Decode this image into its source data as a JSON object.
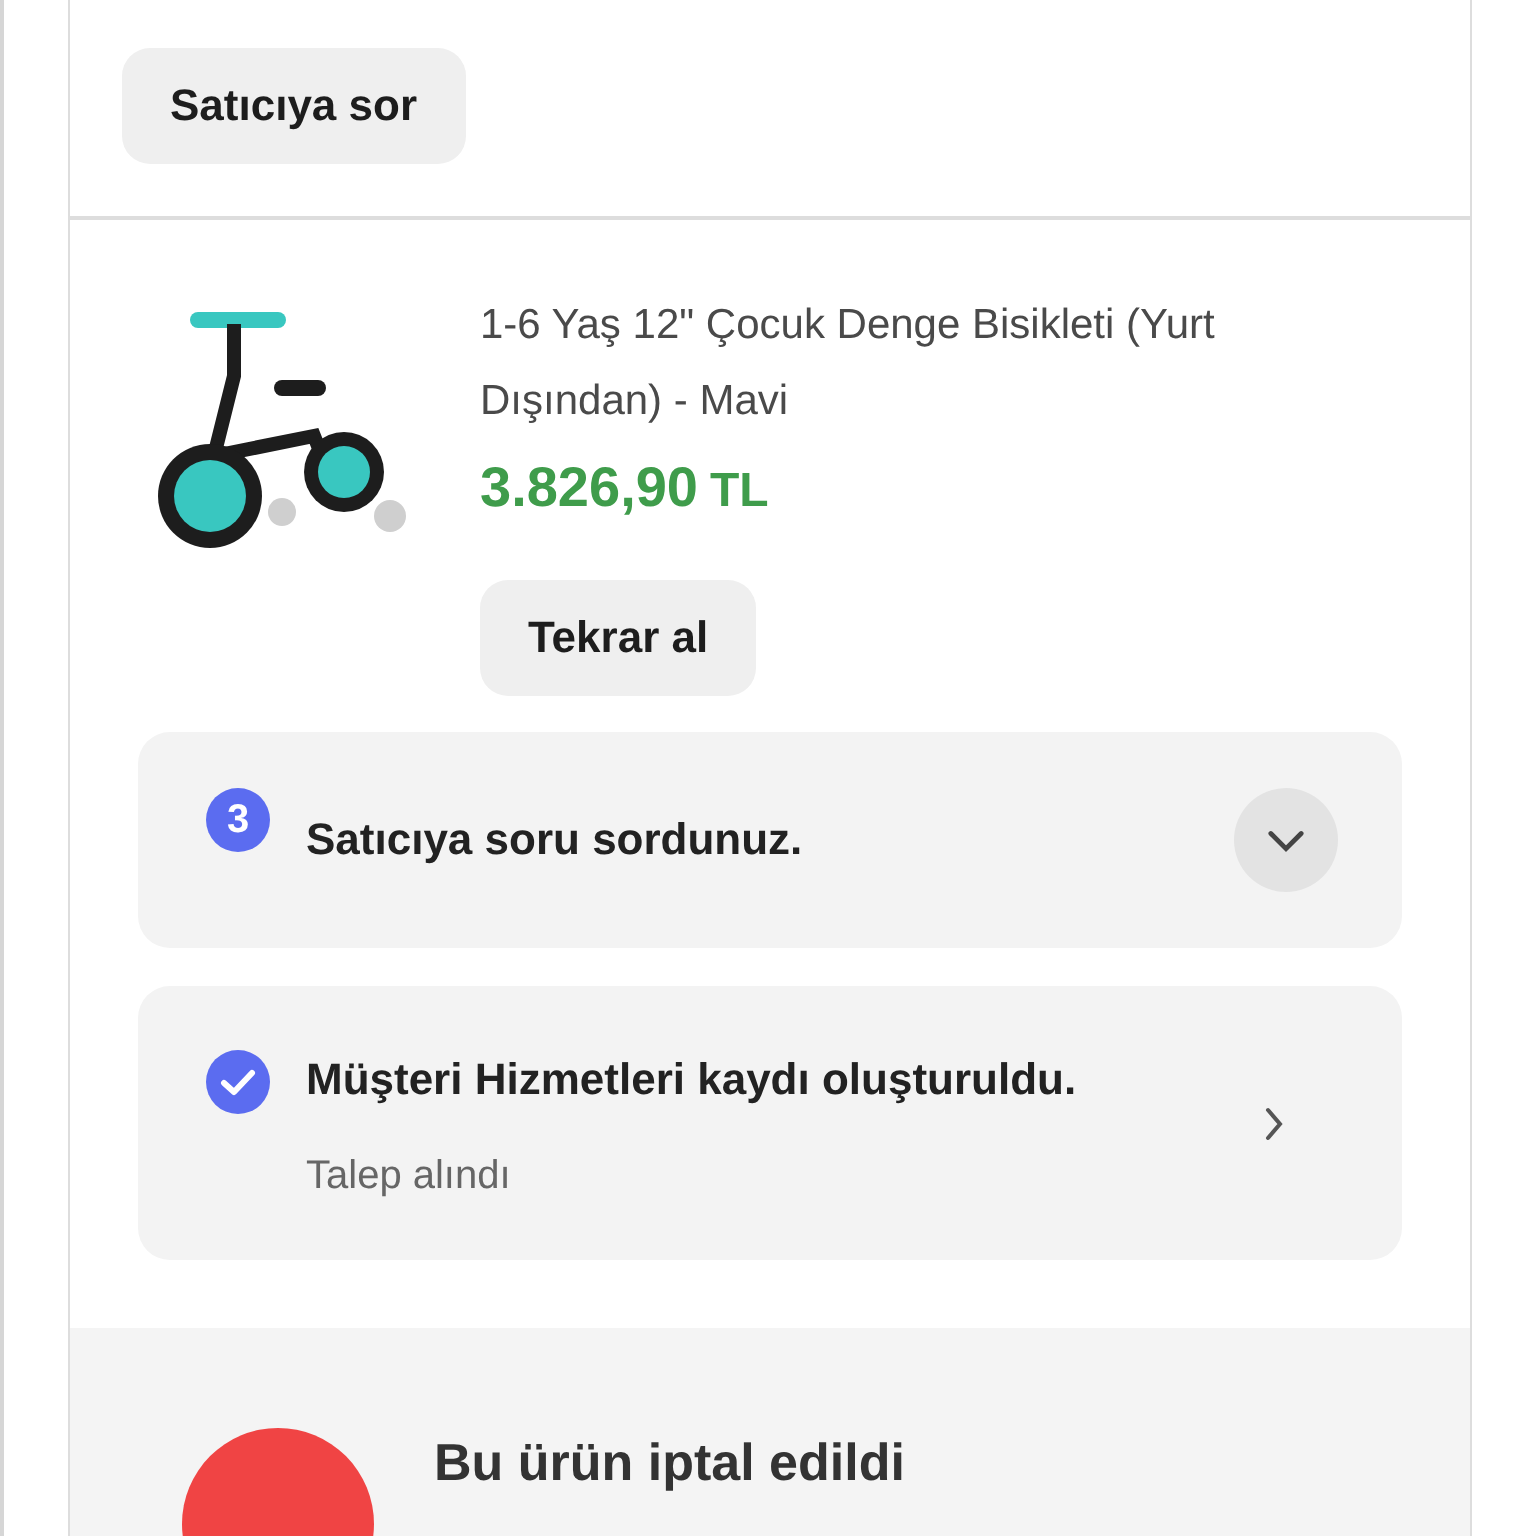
{
  "ask_seller_button": "Satıcıya sor",
  "product": {
    "title": "1-6 Yaş 12\" Çocuk Denge Bisikleti (Yurt Dışından) - Mavi",
    "price": "3.826,90",
    "currency": "TL",
    "buy_again_button": "Tekrar al"
  },
  "status_cards": [
    {
      "kind": "count",
      "badge": "3",
      "title": "Satıcıya soru sordunuz.",
      "expanded": false
    },
    {
      "kind": "done",
      "title": "Müşteri Hizmetleri kaydı oluşturuldu.",
      "subtitle": "Talep alındı"
    }
  ],
  "cancel_notice": {
    "title": "Bu ürün iptal edildi"
  }
}
